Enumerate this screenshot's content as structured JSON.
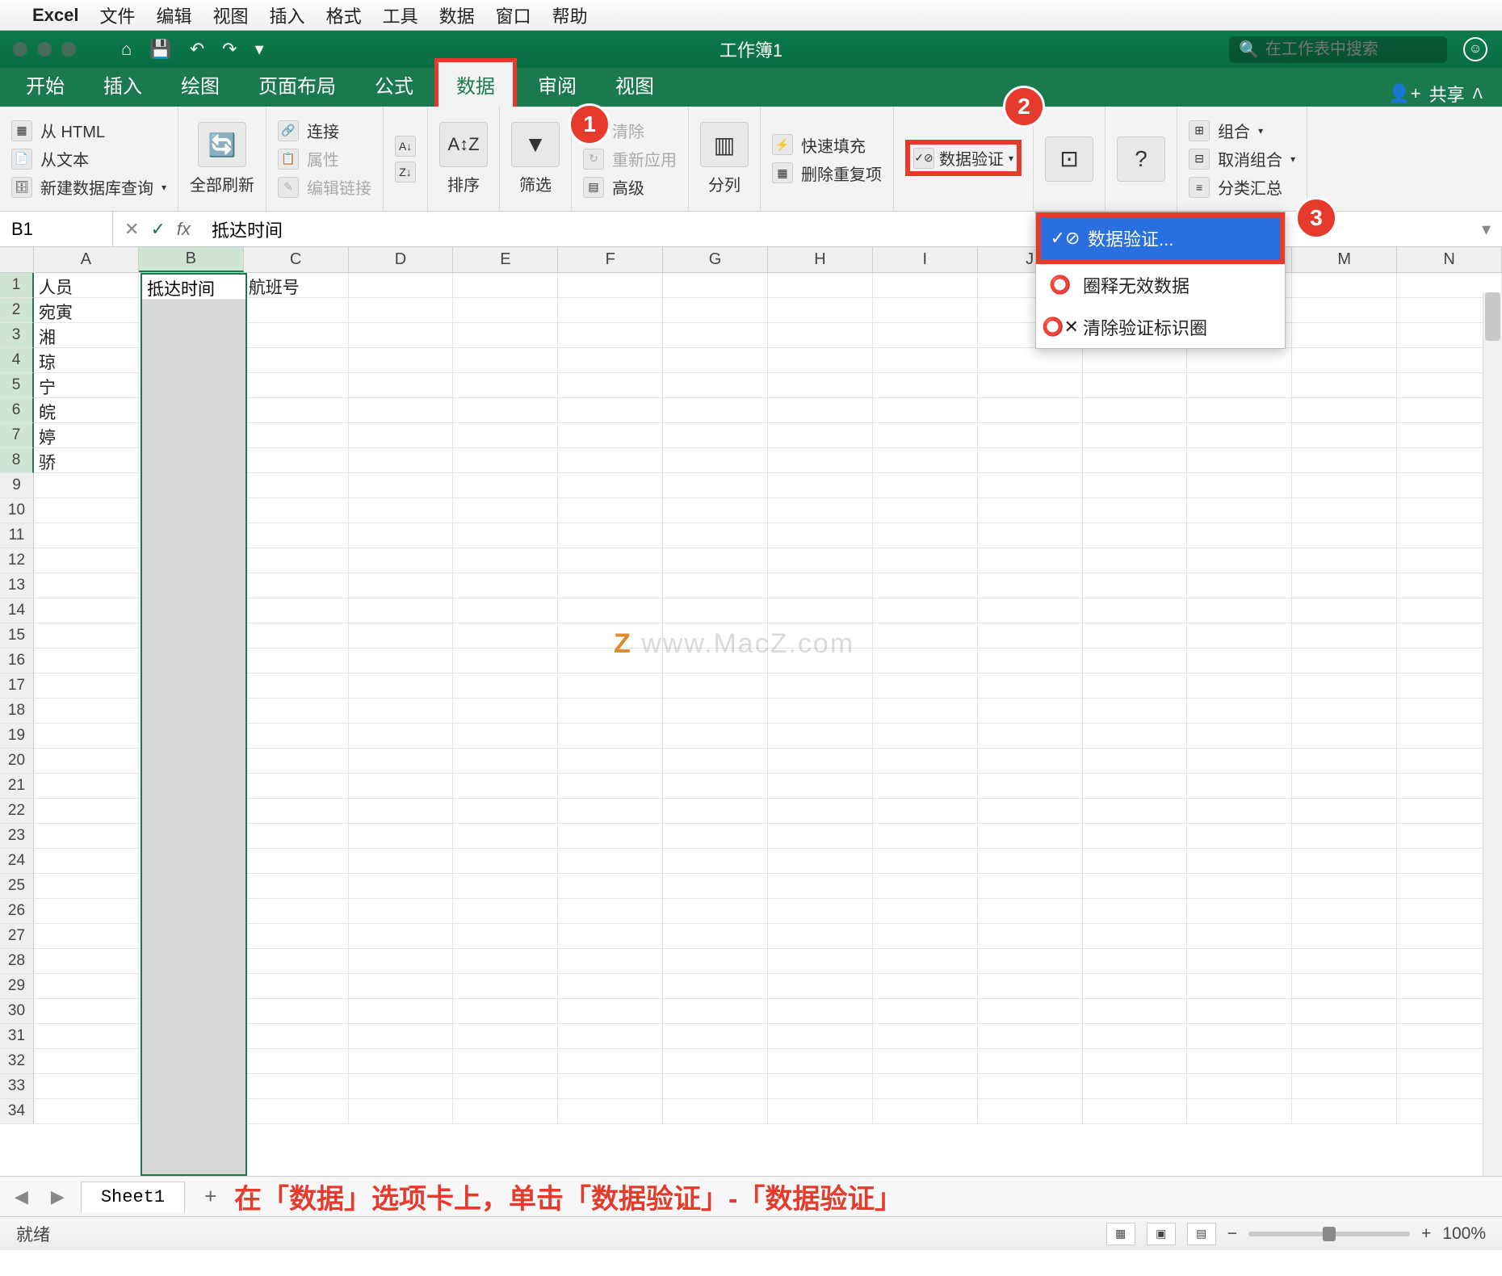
{
  "mac_menu": {
    "app": "Excel",
    "items": [
      "文件",
      "编辑",
      "视图",
      "插入",
      "格式",
      "工具",
      "数据",
      "窗口",
      "帮助"
    ]
  },
  "titlebar": {
    "title": "工作簿1",
    "search_placeholder": "在工作表中搜索"
  },
  "ribbon_tabs": [
    "开始",
    "插入",
    "绘图",
    "页面布局",
    "公式",
    "数据",
    "审阅",
    "视图"
  ],
  "active_tab": "数据",
  "share_label": "共享",
  "ribbon": {
    "from_html": "从 HTML",
    "from_text": "从文本",
    "new_db_query": "新建数据库查询",
    "refresh_all": "全部刷新",
    "connections": "连接",
    "properties": "属性",
    "edit_links": "编辑链接",
    "sort_az": "A→Z",
    "sort_za": "Z→A",
    "sort": "排序",
    "filter": "筛选",
    "clear": "清除",
    "reapply": "重新应用",
    "advanced": "高级",
    "text_to_cols": "分列",
    "flash_fill": "快速填充",
    "remove_dup": "删除重复项",
    "data_validation": "数据验证",
    "consolidate": "合并计算",
    "whatif": "模拟分析",
    "group": "组合",
    "ungroup": "取消组合",
    "subtotal": "分类汇总"
  },
  "dropdown": {
    "dv": "数据验证...",
    "circle": "圈释无效数据",
    "clear_circle": "清除验证标识圈"
  },
  "badges": {
    "b1": "1",
    "b2": "2",
    "b3": "3"
  },
  "name_box": "B1",
  "formula": "抵达时间",
  "columns": [
    "A",
    "B",
    "C",
    "D",
    "E",
    "F",
    "G",
    "H",
    "I",
    "J",
    "K",
    "L",
    "M",
    "N"
  ],
  "rows": 34,
  "data_cells": {
    "A1": "人员",
    "B1": "抵达时间",
    "C1": "航班号",
    "A2": "宛寅",
    "A3": "湘",
    "A4": "琼",
    "A5": "宁",
    "A6": "皖",
    "A7": "婷",
    "A8": "骄"
  },
  "sheet_tab": "Sheet1",
  "caption": "在「数据」选项卡上，单击「数据验证」-「数据验证」",
  "status": "就绪",
  "zoom": "100%",
  "watermark": "www.MacZ.com"
}
